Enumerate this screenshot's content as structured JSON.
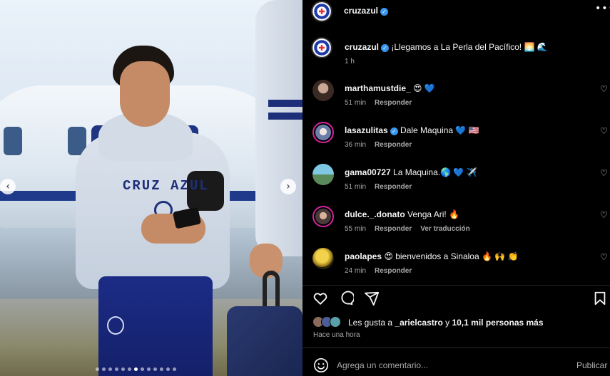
{
  "post": {
    "author": "cruzazul",
    "caption": "¡Llegamos a La Perla del Pacífico! 🌅 🌊",
    "caption_time": "1 h",
    "photo_text": "CRUZ AZUL",
    "carousel_dot_count": 13,
    "carousel_active_index": 6
  },
  "icons": {
    "verified": "verified-check-icon",
    "more": "more-options-icon",
    "like": "heart-icon",
    "comment": "comment-icon",
    "share": "share-icon",
    "save": "bookmark-icon",
    "emoji": "emoji-icon"
  },
  "comments": [
    {
      "user": "marthamustdie_",
      "verified": false,
      "text": "😍 💙",
      "time": "51 min",
      "reply": "Responder",
      "translate": ""
    },
    {
      "user": "lasazulitas",
      "verified": true,
      "text": "Dale Maquina 💙 🇺🇸",
      "time": "36 min",
      "reply": "Responder",
      "translate": ""
    },
    {
      "user": "gama00727",
      "verified": false,
      "text": "La Maquina.🌎 💙 ✈️",
      "time": "51 min",
      "reply": "Responder",
      "translate": ""
    },
    {
      "user": "dulce._.donato",
      "verified": false,
      "text": "Venga Ari! 🔥",
      "time": "55 min",
      "reply": "Responder",
      "translate": "Ver traducción"
    },
    {
      "user": "paolapes",
      "verified": false,
      "text": "😍 bienvenidos a Sinaloa 🔥 🙌 👏",
      "time": "24 min",
      "reply": "Responder",
      "translate": ""
    }
  ],
  "likes": {
    "prefix": "Les gusta a ",
    "user": "_arielcastro",
    "middle": " y ",
    "others": "10,1 mil personas más"
  },
  "posted_ago": "Hace una hora",
  "comment_box": {
    "placeholder": "Agrega un comentario...",
    "publish_label": "Publicar"
  },
  "colors": {
    "background": "#000000",
    "text": "#f5f5f5",
    "muted": "#a8a8a8",
    "verified": "#3897f0",
    "brand_blue": "#1e3aa8"
  }
}
